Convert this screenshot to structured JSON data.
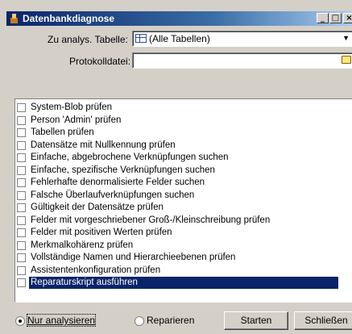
{
  "window": {
    "title": "Datenbankdiagnose"
  },
  "form": {
    "table_label": "Zu analys. Tabelle:",
    "table_value": "(Alle Tabellen)",
    "log_label": "Protokolldatei:",
    "log_value": ""
  },
  "checks": [
    {
      "label": "System-Blob prüfen",
      "checked": false
    },
    {
      "label": "Person 'Admin' prüfen",
      "checked": false
    },
    {
      "label": "Tabellen prüfen",
      "checked": false
    },
    {
      "label": "Datensätze mit Nullkennung prüfen",
      "checked": false
    },
    {
      "label": "Einfache, abgebrochene Verknüpfungen suchen",
      "checked": false
    },
    {
      "label": "Einfache, spezifische Verknüpfungen suchen",
      "checked": false
    },
    {
      "label": "Fehlerhafte denormalisierte Felder suchen",
      "checked": false
    },
    {
      "label": "Falsche Überlaufverknüpfungen suchen",
      "checked": false
    },
    {
      "label": "Gültigkeit der Datensätze prüfen",
      "checked": false
    },
    {
      "label": "Felder mit vorgeschriebener Groß-/Kleinschreibung prüfen",
      "checked": false
    },
    {
      "label": "Felder mit positiven Werten prüfen",
      "checked": false
    },
    {
      "label": "Merkmalkohärenz prüfen",
      "checked": false
    },
    {
      "label": "Vollständige Namen und Hierarchieebenen prüfen",
      "checked": false
    },
    {
      "label": "Assistentenkonfiguration prüfen",
      "checked": false
    },
    {
      "label": "Reparaturskript ausführen",
      "checked": false,
      "selected": true
    }
  ],
  "mode": {
    "analyze_label": "Nur analysieren",
    "repair_label": "Reparieren",
    "selected": "analyze"
  },
  "buttons": {
    "start": "Starten",
    "close": "Schließen"
  },
  "colors": {
    "selection": "#0a246a",
    "titlebar": "#0a246a",
    "face": "#d4d0c8"
  }
}
